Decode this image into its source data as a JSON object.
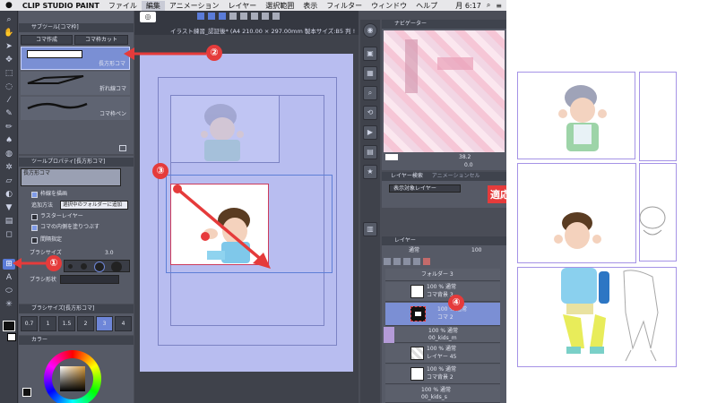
{
  "menubar": {
    "app_name": "CLIP STUDIO PAINT",
    "items": [
      "ファイル",
      "編集",
      "アニメーション",
      "レイヤー",
      "選択範囲",
      "表示",
      "フィルター",
      "ウィンドウ",
      "ヘルプ"
    ],
    "clock": "月 6:17"
  },
  "subtool_panel": {
    "title": "サブツール[コマ枠]",
    "tab_create": "コマ作成",
    "tab_cut": "コマ枠カット",
    "items": [
      "長方形コマ",
      "折れ線コマ",
      "コマ枠ペン"
    ]
  },
  "tool_property": {
    "title": "ツールプロパティ[長方形コマ]",
    "header": "長方形コマ",
    "opt_draw_frame": "枠線を描画",
    "opt_add_method_label": "追加方法",
    "opt_add_method_value": "選択中のフォルダーに追加",
    "opt_raster": "ラスターレイヤー",
    "opt_fill_inside": "コマの内側を塗りつぶす",
    "opt_spacing": "間隔指定",
    "brush_size_label": "ブラシサイズ",
    "brush_size_value": "3.0",
    "brush_shape_label": "ブラシ形状"
  },
  "brush_size_panel": {
    "title": "ブラシサイズ[長方形コマ]",
    "sizes": [
      "0.7",
      "1",
      "1.5",
      "2",
      "3",
      "4"
    ]
  },
  "color_panel": {
    "title": "カラー"
  },
  "canvas": {
    "title": "イラスト練習_認証後* (A4 210.00 × 297.00mm 製本サイズ:B5 判 !"
  },
  "navigator": {
    "title": "ナビゲーター",
    "zoom": "38.2",
    "rotate": "0.0"
  },
  "layer_search": {
    "tab": "レイヤー検索",
    "tab2": "アニメーションセル",
    "filter": "表示対象レイヤー"
  },
  "layers": {
    "title": "レイヤー",
    "blend_mode": "通常",
    "opacity": "100",
    "rows": [
      {
        "line1": "フォルダー 3",
        "line2": ""
      },
      {
        "line1": "100 % 通常",
        "line2": "コマ背景 3"
      },
      {
        "line1": "100 % 通常",
        "line2": "コマ 2"
      },
      {
        "line1": "100 % 通常",
        "line2": "00_kids_m"
      },
      {
        "line1": "100 % 通常",
        "line2": "レイヤー 45"
      },
      {
        "line1": "100 % 通常",
        "line2": "コマ背景 2"
      },
      {
        "line1": "100 % 通常",
        "line2": "00_kids_s"
      }
    ]
  },
  "callouts": [
    "①",
    "②",
    "③",
    "④"
  ],
  "result_label": "適応後",
  "colors": {
    "accent_red": "#e53b3b",
    "frame_purple": "#a593e6",
    "panel_dark": "#4a4d57",
    "page_blue": "#b8bdf0",
    "selection_blue": "#5a7bd8"
  }
}
